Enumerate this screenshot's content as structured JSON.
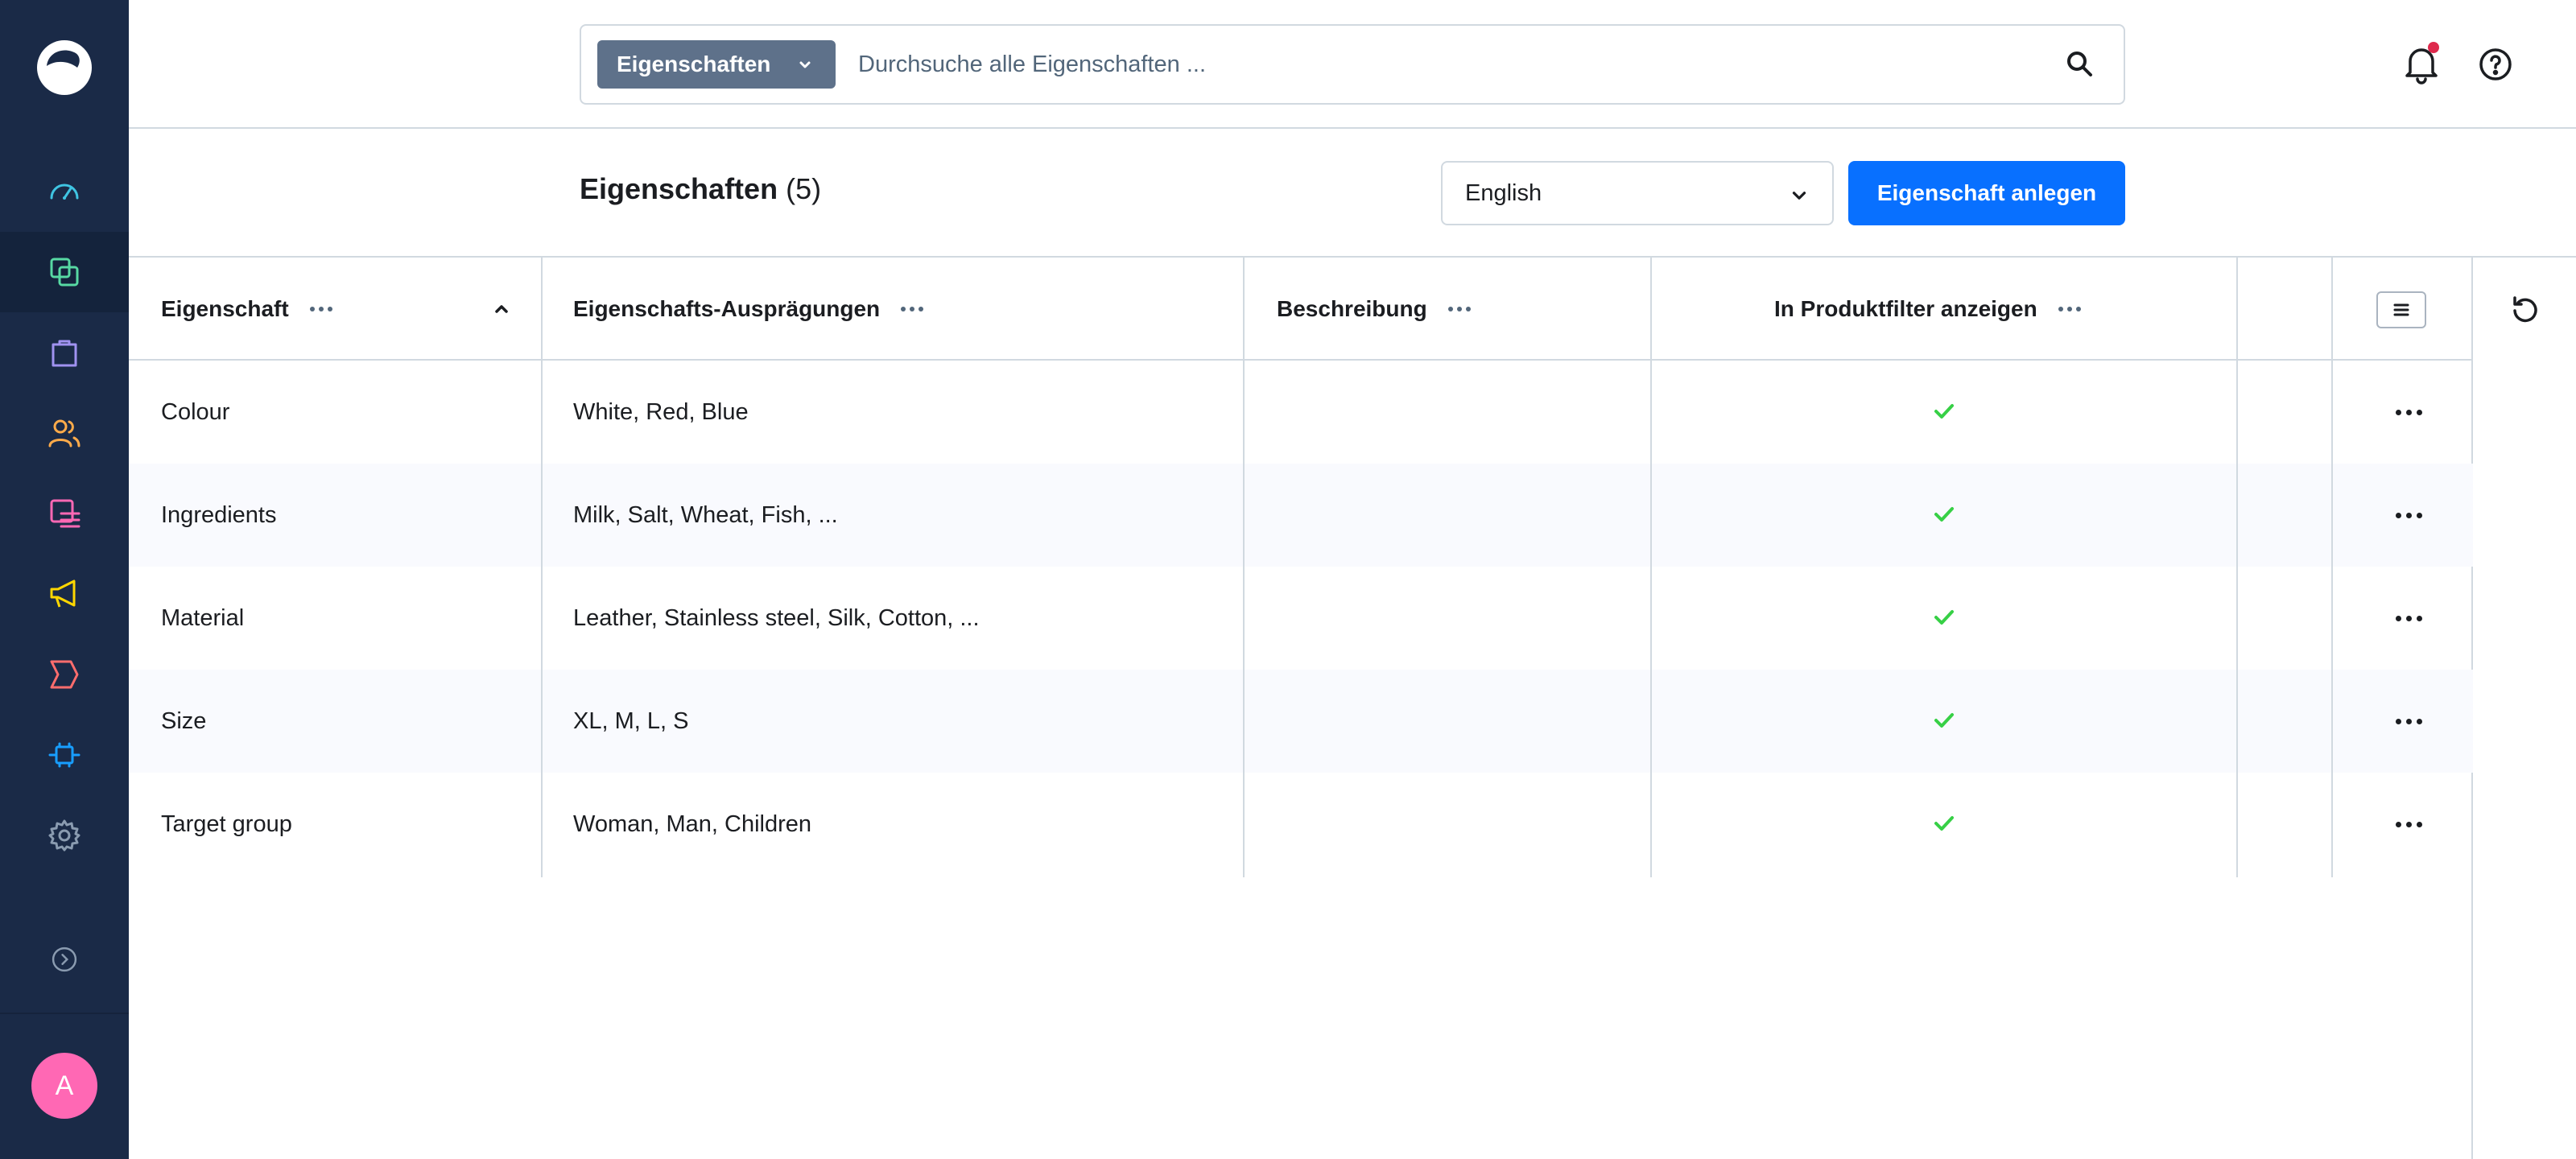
{
  "colors": {
    "sidebar_bg": "#1a2a47",
    "primary": "#0870ff",
    "check": "#37d046",
    "avatar": "#ff68b4",
    "notification": "#de294c"
  },
  "sidebar": {
    "logo": "shopware-logo",
    "items": [
      {
        "icon": "dashboard-icon"
      },
      {
        "icon": "catalogue-icon"
      },
      {
        "icon": "orders-icon"
      },
      {
        "icon": "customers-icon"
      },
      {
        "icon": "content-icon"
      },
      {
        "icon": "marketing-icon"
      },
      {
        "icon": "sales-channels-icon"
      },
      {
        "icon": "extensions-icon"
      },
      {
        "icon": "settings-icon"
      }
    ],
    "collapse_icon": "collapse-arrow-icon",
    "avatar_initial": "A"
  },
  "topbar": {
    "search_type": "Eigenschaften",
    "search_placeholder": "Durchsuche alle Eigenschaften ..."
  },
  "smartbar": {
    "title": "Eigenschaften",
    "count": "(5)",
    "language": "English",
    "create_button": "Eigenschaft anlegen"
  },
  "grid": {
    "columns": [
      {
        "label": "Eigenschaft",
        "sorted": "asc"
      },
      {
        "label": "Eigenschafts-Ausprägungen"
      },
      {
        "label": "Beschreibung"
      },
      {
        "label": "In Produktfilter anzeigen"
      }
    ],
    "rows": [
      {
        "name": "Colour",
        "values": "White, Red, Blue",
        "description": "",
        "filter": true
      },
      {
        "name": "Ingredients",
        "values": "Milk, Salt, Wheat, Fish, ...",
        "description": "",
        "filter": true
      },
      {
        "name": "Material",
        "values": "Leather, Stainless steel, Silk, Cotton, ...",
        "description": "",
        "filter": true
      },
      {
        "name": "Size",
        "values": "XL, M, L, S",
        "description": "",
        "filter": true
      },
      {
        "name": "Target group",
        "values": "Woman, Man, Children",
        "description": "",
        "filter": true
      }
    ]
  }
}
